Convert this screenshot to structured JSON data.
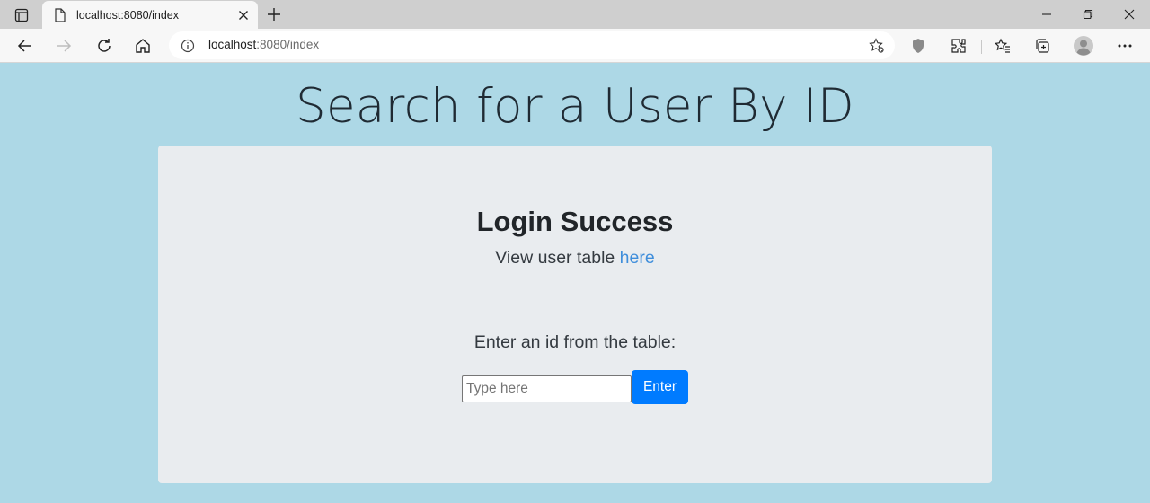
{
  "browser": {
    "tab_title": "localhost:8080/index",
    "url_host": "localhost",
    "url_path": ":8080/index"
  },
  "page": {
    "title": "Search for a User By ID",
    "heading": "Login Success",
    "subtext_prefix": "View user table ",
    "subtext_link": "here",
    "prompt": "Enter an id from the table:",
    "input_placeholder": "Type here",
    "input_value": "",
    "button_label": "Enter"
  },
  "colors": {
    "page_bg": "#add8e6",
    "card_bg": "#e9ecef",
    "button": "#007bff",
    "link": "#3f8edb"
  },
  "icons": [
    "sidebar-icon",
    "page-icon",
    "close-icon",
    "plus-icon",
    "minimize-icon",
    "restore-icon",
    "window-close-icon",
    "back-icon",
    "forward-icon",
    "reload-icon",
    "home-icon",
    "info-icon",
    "favorite-add-icon",
    "shield-icon",
    "extensions-icon",
    "favorites-icon",
    "collections-icon",
    "profile-icon",
    "more-icon"
  ]
}
